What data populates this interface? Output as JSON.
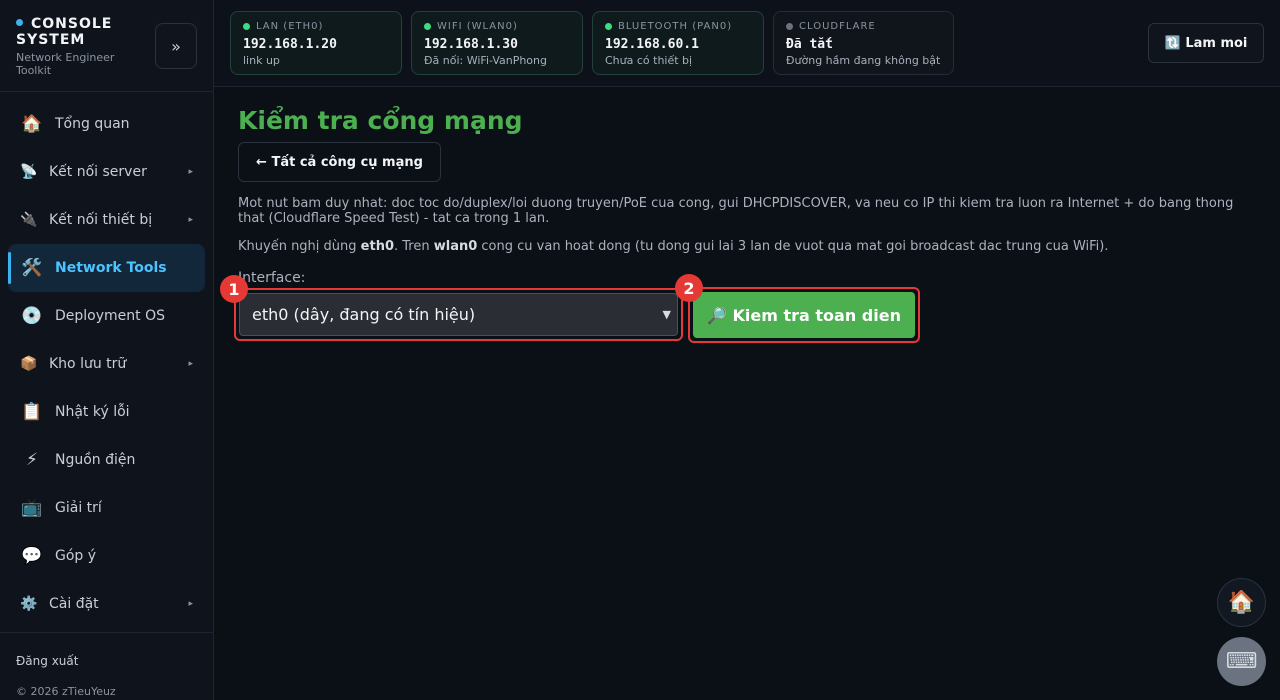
{
  "sidebar": {
    "brand_title": "CONSOLE SYSTEM",
    "brand_subtitle": "Network Engineer Toolkit",
    "collapse_label": "»",
    "items": [
      {
        "label": "Tổng quan",
        "icon": "🏠",
        "chevron": ""
      },
      {
        "label": "Kết nối server",
        "icon": "📡",
        "chevron": "▸"
      },
      {
        "label": "Kết nối thiết bị",
        "icon": "🔌",
        "chevron": "▸"
      },
      {
        "label": "Network Tools",
        "icon": "🛠️",
        "chevron": ""
      },
      {
        "label": "Deployment OS",
        "icon": "💿",
        "chevron": ""
      },
      {
        "label": "Kho lưu trữ",
        "icon": "📦",
        "chevron": "▸"
      },
      {
        "label": "Nhật ký lỗi",
        "icon": "📋",
        "chevron": ""
      },
      {
        "label": "Nguồn điện",
        "icon": "⚡",
        "chevron": ""
      },
      {
        "label": "Giải trí",
        "icon": "📺",
        "chevron": ""
      },
      {
        "label": "Góp ý",
        "icon": "💬",
        "chevron": ""
      },
      {
        "label": "Cài đặt",
        "icon": "⚙️",
        "chevron": "▸"
      }
    ],
    "logout_label": "Đăng xuất",
    "copyright": "© 2026 zTieuYeuz"
  },
  "topbar": {
    "cards": [
      {
        "label": "LAN (ETH0)",
        "value": "192.168.1.20",
        "sub": "link up",
        "status": "on"
      },
      {
        "label": "WIFI (WLAN0)",
        "value": "192.168.1.30",
        "sub": "Đã nối: WiFi-VanPhong",
        "status": "on"
      },
      {
        "label": "BLUETOOTH (PAN0)",
        "value": "192.168.60.1",
        "sub": "Chưa có thiết bị",
        "status": "on"
      },
      {
        "label": "CLOUDFLARE",
        "value": "Đã tắt",
        "sub": "Đường hầm đang không bật",
        "status": "off"
      }
    ],
    "refresh_label": "🔃 Lam moi"
  },
  "main": {
    "title": "Kiểm tra cổng mạng",
    "back_label": "← Tất cả công cụ mạng",
    "description": "Mot nut bam duy nhat: doc toc do/duplex/loi duong truyen/PoE cua cong, gui DHCPDISCOVER, va neu co IP thi kiem tra luon ra Internet + do bang thong that (Cloudflare Speed Test) - tat ca trong 1 lan.",
    "hint_prefix": "Khuyến nghị dùng ",
    "hint_eth": "eth0",
    "hint_mid": ". Tren ",
    "hint_wlan": "wlan0",
    "hint_suffix": " cong cu van hoat dong (tu dong gui lai 3 lan de vuot qua mat goi broadcast dac trung cua WiFi).",
    "interface_label": "Interface:",
    "interface_value": "eth0 (dây, đang có tín hiệu)",
    "run_label": "🔎 Kiem tra toan dien",
    "marker_1": "1",
    "marker_2": "2"
  },
  "fabs": {
    "home_icon": "🏠",
    "keyboard_icon": "⌨"
  },
  "colors": {
    "accent": "#4cc3ff",
    "title_green": "#4caf50",
    "marker_red": "#e53935",
    "status_on": "#3ddc84"
  }
}
